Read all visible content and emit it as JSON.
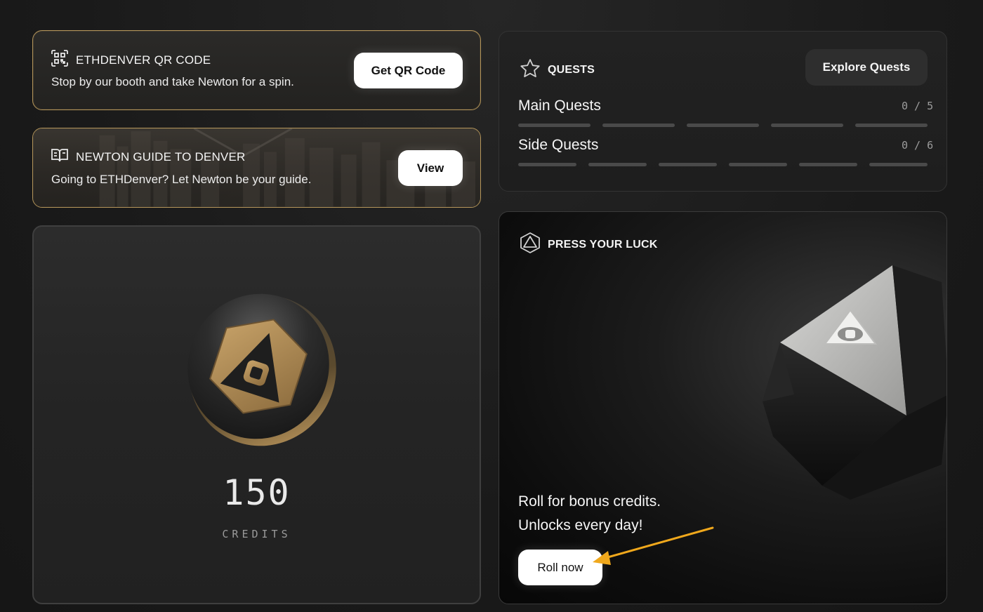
{
  "qr_card": {
    "title": "ETHDENVER QR CODE",
    "subtitle": "Stop by our booth and take Newton for a spin.",
    "button": "Get QR Code",
    "icon": "qr-code-icon"
  },
  "guide_card": {
    "title": "NEWTON GUIDE TO DENVER",
    "subtitle": "Going to ETHDenver? Let Newton be your guide.",
    "button": "View",
    "icon": "book-icon"
  },
  "credits": {
    "value": "150",
    "label": "CREDITS"
  },
  "quests": {
    "title": "QUESTS",
    "icon": "star-icon",
    "explore_button": "Explore Quests",
    "main": {
      "label": "Main Quests",
      "count": "0 / 5",
      "completed": 0,
      "total": 5
    },
    "side": {
      "label": "Side Quests",
      "count": "0 / 6",
      "completed": 0,
      "total": 6
    }
  },
  "luck": {
    "title": "PRESS YOUR LUCK",
    "icon": "hexagon-triangle-icon",
    "line1": "Roll for bonus credits.",
    "line2": "Unlocks every day!",
    "button": "Roll now"
  },
  "colors": {
    "gold_border": "#b4955a",
    "coin_gold": "#b08a4e",
    "annotation_arrow": "#f0a81c"
  }
}
